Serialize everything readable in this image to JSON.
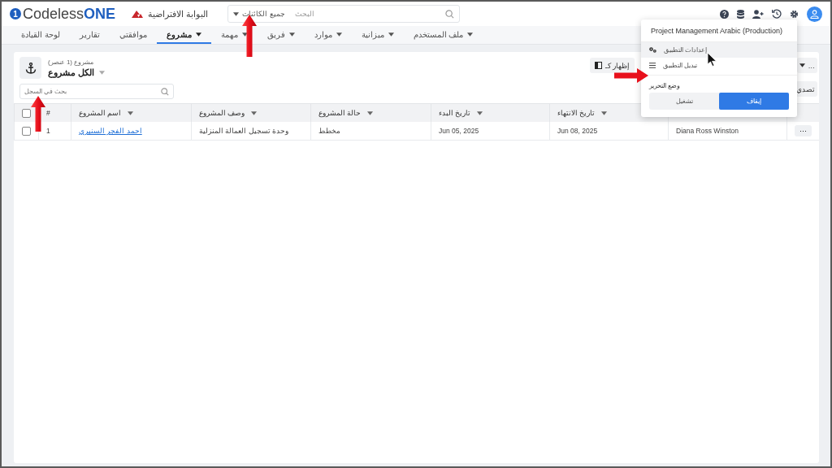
{
  "header": {
    "logo": {
      "mark": "1",
      "brand": "Codeless",
      "suffix": "ONE"
    },
    "portal": "البوابة الافتراضية",
    "search": {
      "scope": "جميع الكائنات",
      "placeholder": "البحث"
    }
  },
  "nav": [
    {
      "label": "ملف المستخدم",
      "dropdown": true,
      "selected": false
    },
    {
      "label": "ميزانية",
      "dropdown": true,
      "selected": false
    },
    {
      "label": "موارد",
      "dropdown": true,
      "selected": false
    },
    {
      "label": "فريق",
      "dropdown": true,
      "selected": false
    },
    {
      "label": "مهمة",
      "dropdown": true,
      "selected": false
    },
    {
      "label": "مشروع",
      "dropdown": true,
      "selected": true
    },
    {
      "label": "موافقتي",
      "dropdown": false,
      "selected": false
    },
    {
      "label": "تقارير",
      "dropdown": false,
      "selected": false
    },
    {
      "label": "لوحة القيادة",
      "dropdown": false,
      "selected": false
    }
  ],
  "list": {
    "count": "مشروع (1 عنصر)",
    "view": "الكل مشروع",
    "search_placeholder": "بحث في السجل",
    "toolbar": [
      {
        "label": "إظهار كـ",
        "kind": "display"
      },
      {
        "label": "…",
        "kind": "more"
      },
      {
        "label": "تصدي",
        "kind": "plain"
      }
    ]
  },
  "table": {
    "select_all": {
      "checked": false
    },
    "columns": [
      "",
      "تاريخ الانتهاء",
      "تاريخ البدء",
      "حالة المشروع",
      "وصف المشروع",
      "اسم المشروع",
      "#"
    ],
    "rows": [
      {
        "checked": false,
        "action": "···",
        "cells": [
          "Diana Ross Winston",
          "Jun 08, 2025",
          "Jun 05, 2025",
          "مخطط",
          "وحدة تسجيل العمالة المنزلية",
          "احمد الفجر السنيري",
          "1"
        ]
      }
    ]
  },
  "menu": {
    "title": "Project Management Arabic (Production)",
    "items": [
      {
        "label": "إعدادات التطبيق",
        "kind": "settings",
        "hovered": true
      },
      {
        "label": "تبديل التطبيق",
        "kind": "switch",
        "hovered": false
      }
    ],
    "edit_mode": {
      "label": "وضع التحرير",
      "options": [
        {
          "label": "إيقاف",
          "selected": true
        },
        {
          "label": "تشغيل",
          "selected": false
        }
      ]
    }
  }
}
